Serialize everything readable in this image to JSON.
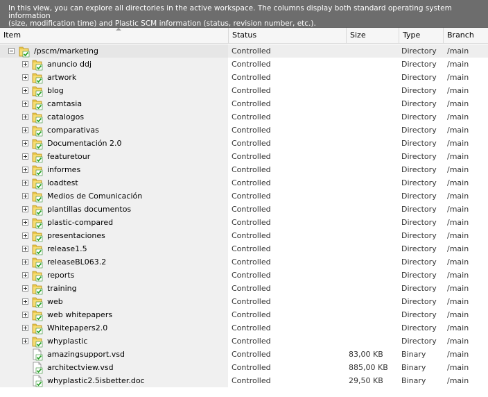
{
  "info": {
    "line1": "In this view, you can explore all directories in the active workspace. The columns display both standard operating system information",
    "line2": "(size, modification time) and Plastic SCM information (status, revision number, etc.)."
  },
  "columns": {
    "item": "Item",
    "status": "Status",
    "size": "Size",
    "type": "Type",
    "branch": "Branch"
  },
  "icons": {
    "folder": "folder-controlled-icon",
    "file": "file-controlled-icon",
    "folder_color": "#e9c84a",
    "check_color": "#29a329"
  },
  "root": {
    "name": "/pscm/marketing",
    "status": "Controlled",
    "size": "",
    "type": "Directory",
    "branch": "/main",
    "expanded": true
  },
  "rows": [
    {
      "name": "anuncio ddj",
      "status": "Controlled",
      "size": "",
      "type": "Directory",
      "branch": "/main"
    },
    {
      "name": "artwork",
      "status": "Controlled",
      "size": "",
      "type": "Directory",
      "branch": "/main"
    },
    {
      "name": "blog",
      "status": "Controlled",
      "size": "",
      "type": "Directory",
      "branch": "/main"
    },
    {
      "name": "camtasia",
      "status": "Controlled",
      "size": "",
      "type": "Directory",
      "branch": "/main"
    },
    {
      "name": "catalogos",
      "status": "Controlled",
      "size": "",
      "type": "Directory",
      "branch": "/main"
    },
    {
      "name": "comparativas",
      "status": "Controlled",
      "size": "",
      "type": "Directory",
      "branch": "/main"
    },
    {
      "name": "Documentación 2.0",
      "status": "Controlled",
      "size": "",
      "type": "Directory",
      "branch": "/main"
    },
    {
      "name": "featuretour",
      "status": "Controlled",
      "size": "",
      "type": "Directory",
      "branch": "/main"
    },
    {
      "name": "informes",
      "status": "Controlled",
      "size": "",
      "type": "Directory",
      "branch": "/main"
    },
    {
      "name": "loadtest",
      "status": "Controlled",
      "size": "",
      "type": "Directory",
      "branch": "/main"
    },
    {
      "name": "Medios de Comunicación",
      "status": "Controlled",
      "size": "",
      "type": "Directory",
      "branch": "/main"
    },
    {
      "name": "plantillas documentos",
      "status": "Controlled",
      "size": "",
      "type": "Directory",
      "branch": "/main"
    },
    {
      "name": "plastic-compared",
      "status": "Controlled",
      "size": "",
      "type": "Directory",
      "branch": "/main"
    },
    {
      "name": "presentaciones",
      "status": "Controlled",
      "size": "",
      "type": "Directory",
      "branch": "/main"
    },
    {
      "name": "release1.5",
      "status": "Controlled",
      "size": "",
      "type": "Directory",
      "branch": "/main"
    },
    {
      "name": "releaseBL063.2",
      "status": "Controlled",
      "size": "",
      "type": "Directory",
      "branch": "/main"
    },
    {
      "name": "reports",
      "status": "Controlled",
      "size": "",
      "type": "Directory",
      "branch": "/main"
    },
    {
      "name": "training",
      "status": "Controlled",
      "size": "",
      "type": "Directory",
      "branch": "/main"
    },
    {
      "name": "web",
      "status": "Controlled",
      "size": "",
      "type": "Directory",
      "branch": "/main"
    },
    {
      "name": "web whitepapers",
      "status": "Controlled",
      "size": "",
      "type": "Directory",
      "branch": "/main"
    },
    {
      "name": "Whitepapers2.0",
      "status": "Controlled",
      "size": "",
      "type": "Directory",
      "branch": "/main"
    },
    {
      "name": "whyplastic",
      "status": "Controlled",
      "size": "",
      "type": "Directory",
      "branch": "/main"
    },
    {
      "name": "amazingsupport.vsd",
      "status": "Controlled",
      "size": "83,00 KB",
      "type": "Binary",
      "branch": "/main"
    },
    {
      "name": "architectview.vsd",
      "status": "Controlled",
      "size": "885,00 KB",
      "type": "Binary",
      "branch": "/main"
    },
    {
      "name": "whyplastic2.5isbetter.doc",
      "status": "Controlled",
      "size": "29,50 KB",
      "type": "Binary",
      "branch": "/main"
    }
  ]
}
